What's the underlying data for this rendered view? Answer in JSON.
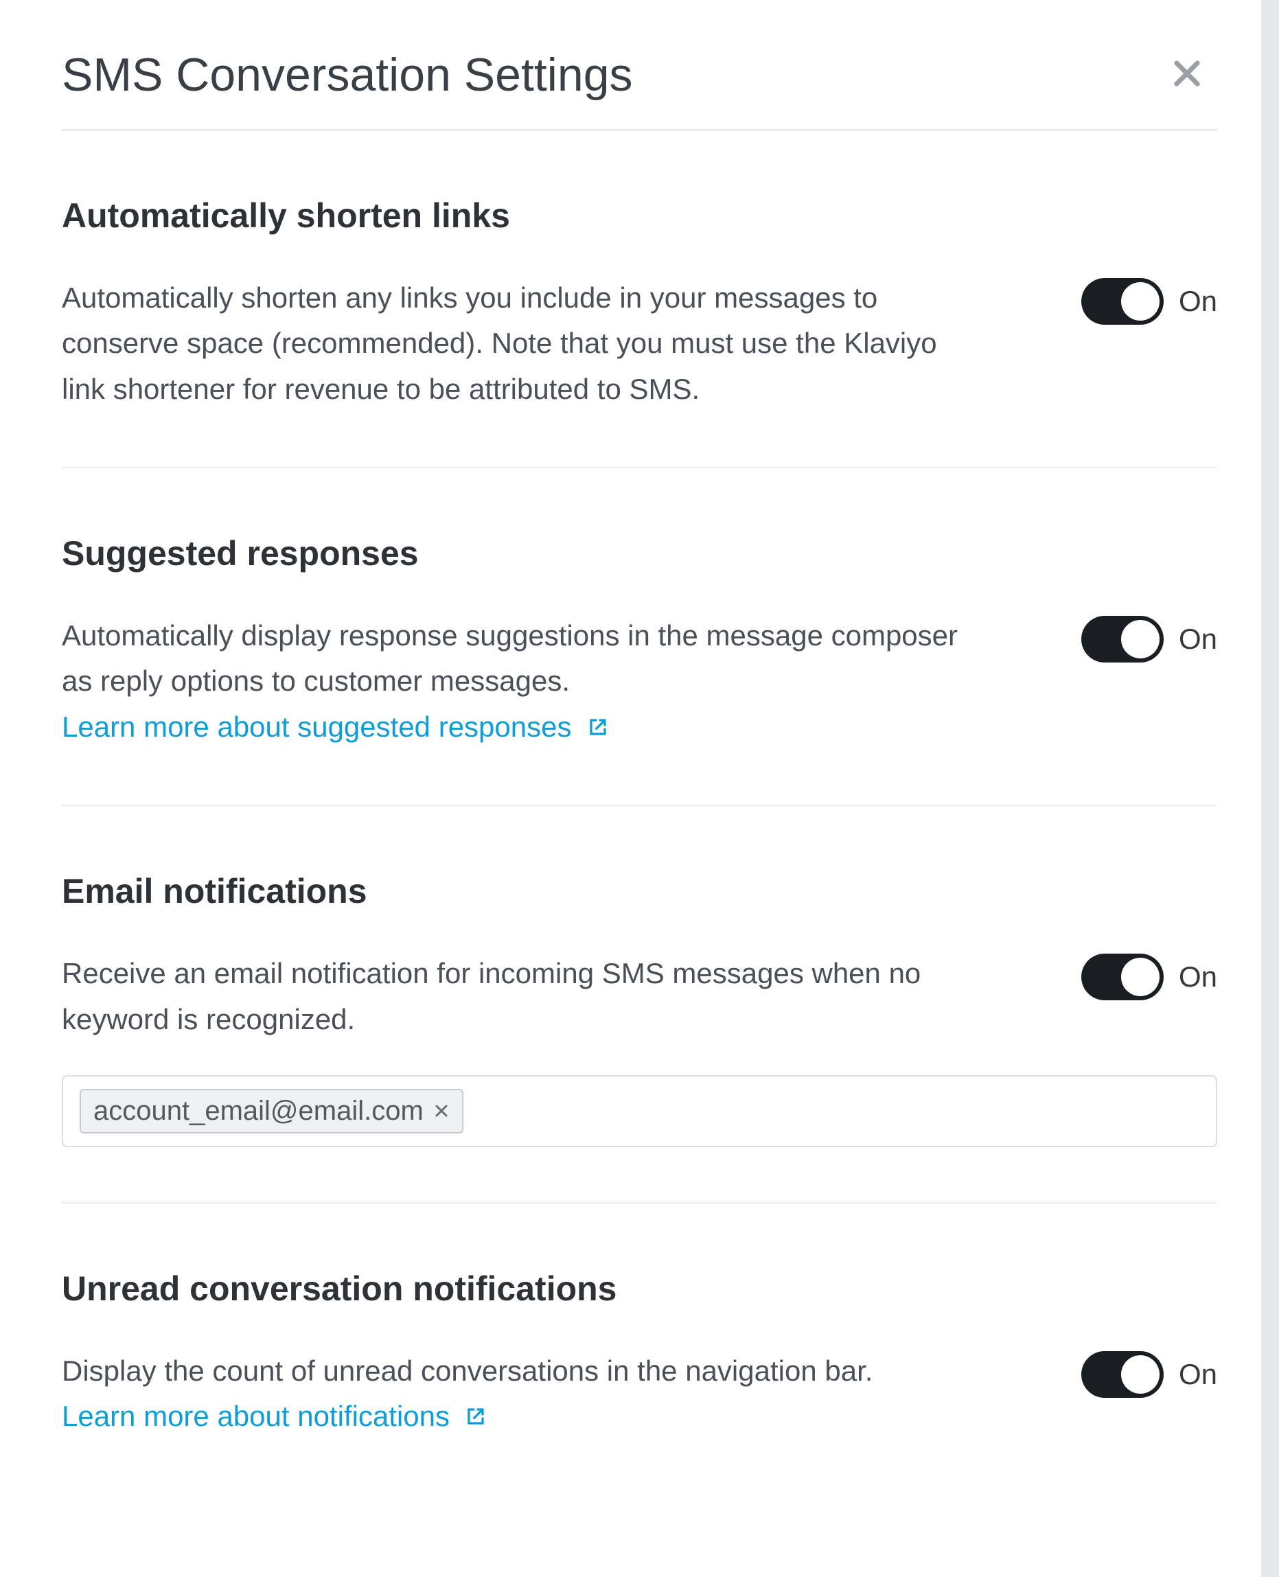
{
  "modal": {
    "title": "SMS Conversation Settings"
  },
  "sections": {
    "shorten_links": {
      "heading": "Automatically shorten links",
      "description": "Automatically shorten any links you include in your messages to conserve space (recommended). Note that you must use the Klaviyo link shortener for revenue to be attributed to SMS.",
      "toggle_state": "On"
    },
    "suggested_responses": {
      "heading": "Suggested responses",
      "description": "Automatically display response suggestions in the message composer as reply options to customer messages.",
      "link_text": "Learn more about suggested responses",
      "toggle_state": "On"
    },
    "email_notifications": {
      "heading": "Email notifications",
      "description": "Receive an email notification for incoming SMS messages when no keyword is recognized.",
      "toggle_state": "On",
      "email_chip": "account_email@email.com"
    },
    "unread_notifications": {
      "heading": "Unread conversation notifications",
      "description": "Display the count of unread conversations in the navigation bar.",
      "link_text": "Learn more about notifications",
      "toggle_state": "On"
    }
  }
}
